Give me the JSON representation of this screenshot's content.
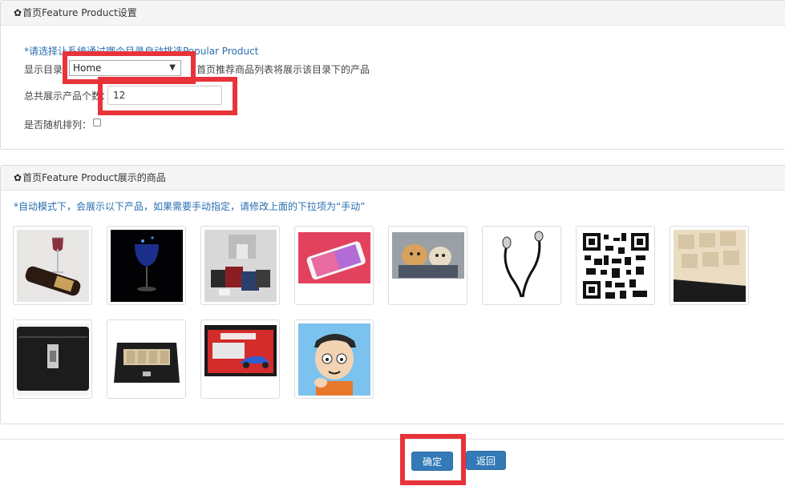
{
  "panel1": {
    "title": "首页Feature Product设置",
    "note": "*请选择让系统通过哪个目录自动挑选Popular Product",
    "category_label": "显示目录",
    "category_value": "Home",
    "category_hint": "首页推荐商品列表将展示该目录下的产品",
    "count_label": "总共展示产品个数：",
    "count_value": "12",
    "random_label": "是否随机排列："
  },
  "panel2": {
    "title": "首页Feature Product展示的商品",
    "note": "*自动模式下，会展示以下产品，如果需要手动指定，请修改上面的下拉项为“手动”",
    "products": [
      "wine-bottle-glass-image",
      "wine-glass-blue-image",
      "handbags-image",
      "smartphone-image",
      "puppies-image",
      "earphones-image",
      "qr-code-image",
      "watch-box-open-image",
      "leather-case-image",
      "watch-box-closed-image",
      "toy-car-box-image",
      "cartoon-avatar-image"
    ]
  },
  "footer": {
    "ok_label": "确定",
    "back_label": "返回"
  },
  "colors": {
    "accent": "#337ab7",
    "note": "#2a6eb0",
    "highlight": "#e8333a"
  }
}
